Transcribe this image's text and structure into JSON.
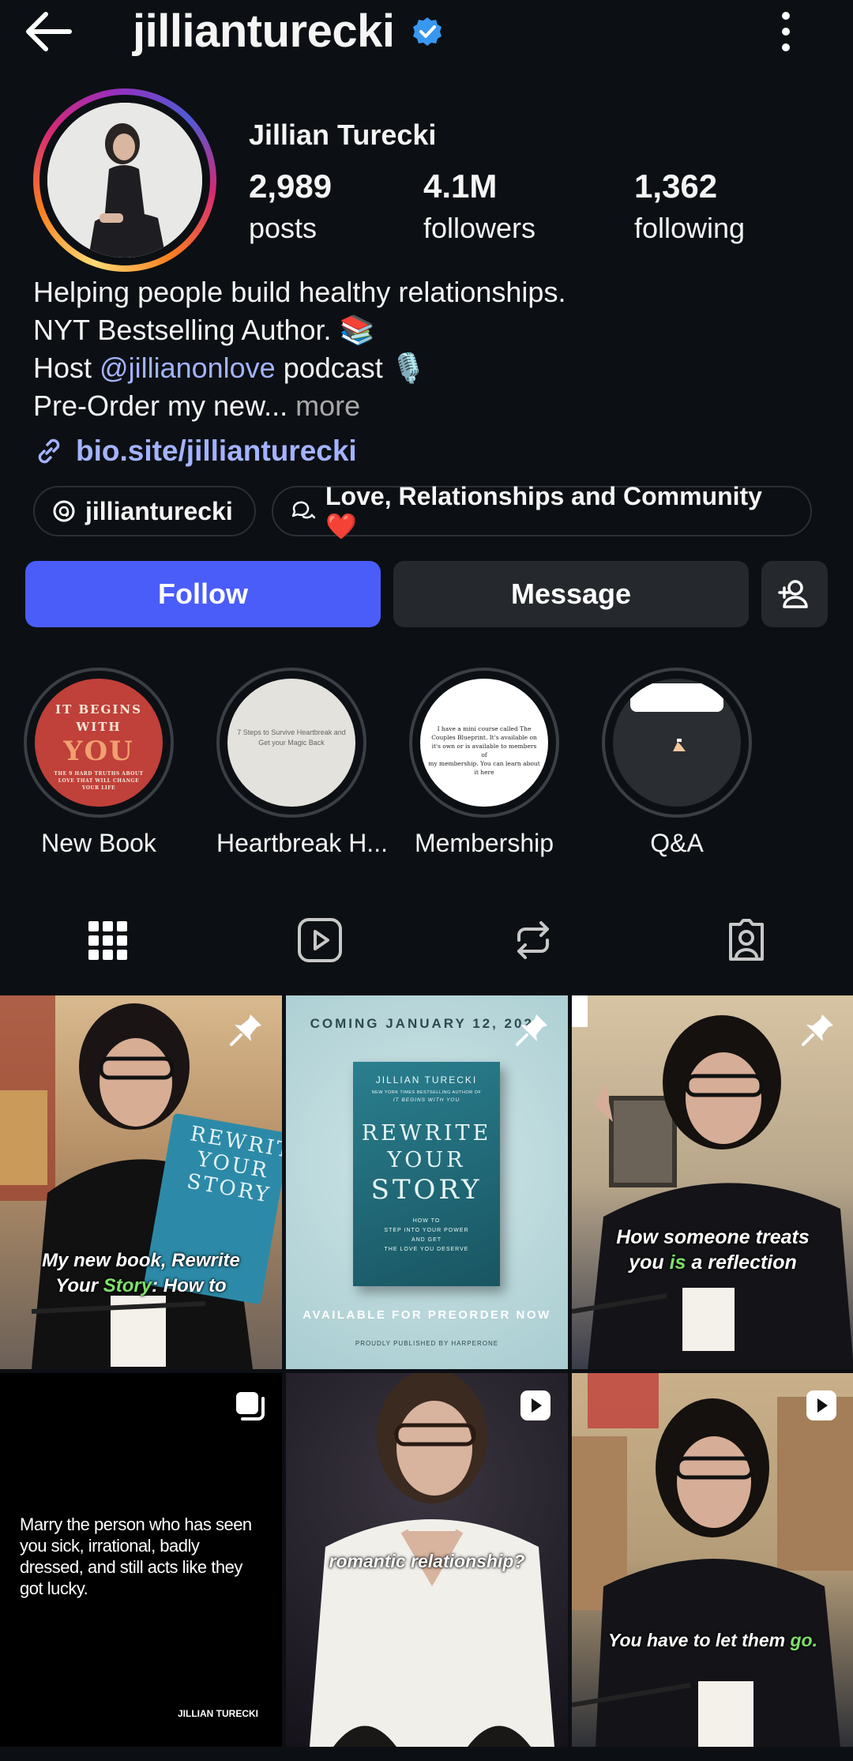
{
  "header": {
    "username": "jillianturecki"
  },
  "profile": {
    "display_name": "Jillian Turecki",
    "stats": {
      "posts_count": "2,989",
      "posts_label": "posts",
      "followers_count": "4.1M",
      "followers_label": "followers",
      "following_count": "1,362",
      "following_label": "following"
    },
    "bio": {
      "line1": "Helping people build healthy relationships.",
      "line2": "NYT Bestselling Author. 📚",
      "line3_prefix": "Host ",
      "line3_mention": "@jillianonlove",
      "line3_suffix": " podcast 🎙️",
      "line4": "Pre-Order my new...",
      "more": "more"
    },
    "link": "bio.site/jillianturecki",
    "threads_pill": "jillianturecki",
    "community_pill": "Love, Relationships and Community ❤️"
  },
  "actions": {
    "follow": "Follow",
    "message": "Message"
  },
  "highlights": [
    {
      "label": "New Book",
      "cover_text": [
        "IT BEGINS",
        "WITH",
        "YOU"
      ],
      "cover_sub": "THE 9 HARD TRUTHS ABOUT LOVE THAT WILL CHANGE YOUR LIFE"
    },
    {
      "label": "Heartbreak H...",
      "cover_text": [
        "7 Steps to Survive Heartbreak and",
        "Get your Magic Back"
      ]
    },
    {
      "label": "Membership",
      "cover_text": [
        "I have a mini course called The",
        "Couples Blueprint. It's available on",
        "it's own or is available to members of",
        "my membership. You can learn about",
        "it here"
      ]
    },
    {
      "label": "Q&A"
    }
  ],
  "tabs": [
    "grid",
    "reels",
    "reposts",
    "tagged"
  ],
  "posts": [
    {
      "caption_1": "My new book, Rewrite",
      "caption_2a": "Your ",
      "caption_2b": "Story",
      "caption_2c": ": How to",
      "book_lines": [
        "REWRITE",
        "YOUR",
        "STORY"
      ],
      "type": "pinned"
    },
    {
      "top_text": "COMING JANUARY 12, 2026",
      "author": "JILLIAN TURECKI",
      "author_sub": "NEW YORK TIMES BESTSELLING AUTHOR OF",
      "author_sub2": "IT BEGINS WITH YOU",
      "title_lines": [
        "REWRITE",
        "YOUR",
        "STORY"
      ],
      "subtitle": [
        "HOW TO",
        "STEP INTO YOUR POWER",
        "AND GET",
        "THE LOVE YOU DESERVE"
      ],
      "bottom_text": "AVAILABLE FOR PREORDER NOW",
      "publisher": "PROUDLY PUBLISHED BY  HARPERONE",
      "type": "pinned"
    },
    {
      "caption_1": "How someone treats",
      "caption_2a": "you ",
      "caption_2b": "is",
      "caption_2c": " a reflection",
      "type": "pinned"
    },
    {
      "quote": "Marry the person who has seen you sick, irrational, badly dressed, and still acts like they got lucky.",
      "signature": "JILLIAN TURECKI",
      "type": "carousel"
    },
    {
      "caption_1": "romantic relationship?",
      "type": "reel"
    },
    {
      "caption_1a": "You have to let them ",
      "caption_1b": "go.",
      "type": "reel"
    }
  ],
  "colors": {
    "background": "#0c1014",
    "follow_button": "#4a5df9",
    "secondary_button": "#25292e",
    "link": "#a3b3ff",
    "verified": "#3897f0",
    "highlight_green": "#7ee06a"
  }
}
